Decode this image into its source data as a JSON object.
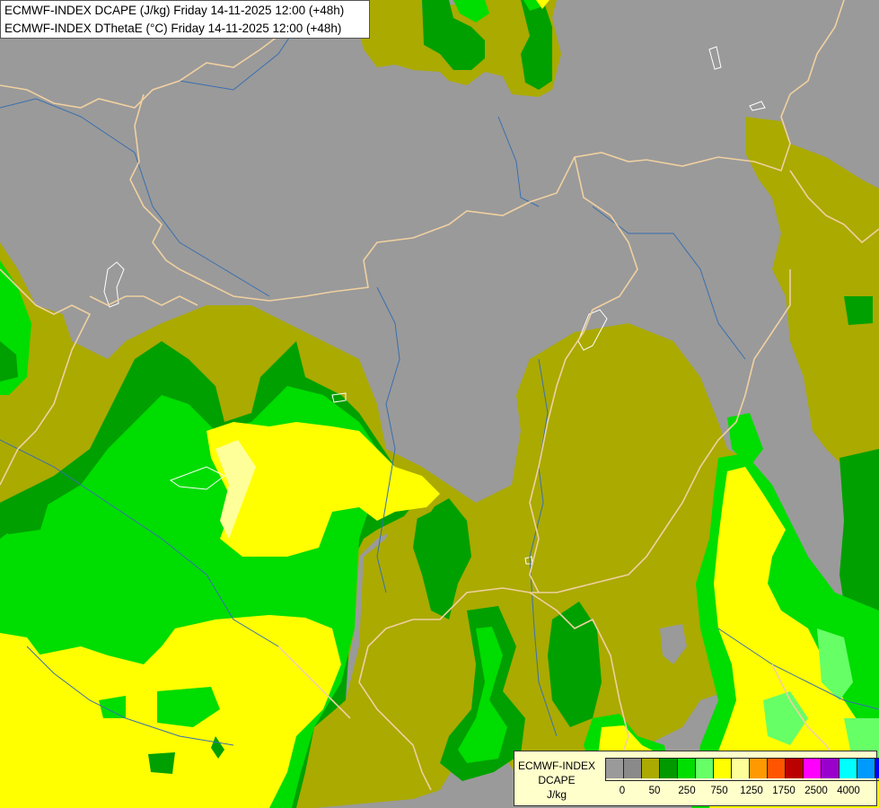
{
  "titles": {
    "line1": "ECMWF-INDEX DCAPE (J/kg) Friday 14-11-2025 12:00 (+48h)",
    "line2": "ECMWF-INDEX DThetaE (°C) Friday 14-11-2025 12:00 (+48h)"
  },
  "legend": {
    "label_line1": "ECMWF-INDEX",
    "label_line2": "DCAPE",
    "label_line3": "J/kg",
    "swatch_colors": [
      "#9a9a9a",
      "#8a8a8a",
      "#aaaa00",
      "#009900",
      "#00dd00",
      "#66ff66",
      "#ffff00",
      "#ffff99",
      "#ff9900",
      "#ff5500",
      "#bb0000",
      "#ff00ff",
      "#9900cc",
      "#00ffff",
      "#0099ff",
      "#0000ff",
      "#000066"
    ],
    "tick_labels": [
      "0",
      "50",
      "250",
      "750",
      "1250",
      "1750",
      "2500",
      "4000"
    ]
  },
  "colors": {
    "background": "#9a9a9a",
    "olive": "#aaaa00",
    "dark_green": "#00a000",
    "green": "#00dd00",
    "light_green": "#66ff66",
    "yellow": "#ffff00",
    "pale_yellow": "#ffff99",
    "border": "#f0d0a0",
    "river": "#3a6fb0"
  }
}
